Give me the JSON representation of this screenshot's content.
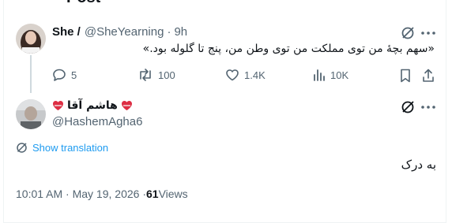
{
  "header": {
    "partial_title": "Post"
  },
  "parent_post": {
    "display_name": "She /",
    "handle": "@SheYearning",
    "separator": "·",
    "time": "9h",
    "text": "«سهم بچهٔ من توی مملکت من توی وطن من، پنج تا گلوله بود.»",
    "actions": {
      "reply_count": "5",
      "repost_count": "100",
      "like_count": "1.4K",
      "view_count": "10K"
    }
  },
  "reply_post": {
    "display_name": "هاشم آقا",
    "name_emoji": "❤️‍🩹",
    "handle": "@HashemAgha6",
    "show_translation": "Show translation",
    "text": "به درک",
    "timestamp": "10:01 AM · May 19, 2026 · ",
    "views_count": "61",
    "views_label": " Views"
  },
  "colors": {
    "accent": "#1d9bf0",
    "muted": "#536471",
    "text": "#0f1419",
    "heart": "#e0245e"
  },
  "icons": [
    "grok-icon",
    "more-icon",
    "reply-icon",
    "repost-icon",
    "like-icon",
    "views-icon",
    "bookmark-icon",
    "share-icon",
    "translate-icon"
  ]
}
